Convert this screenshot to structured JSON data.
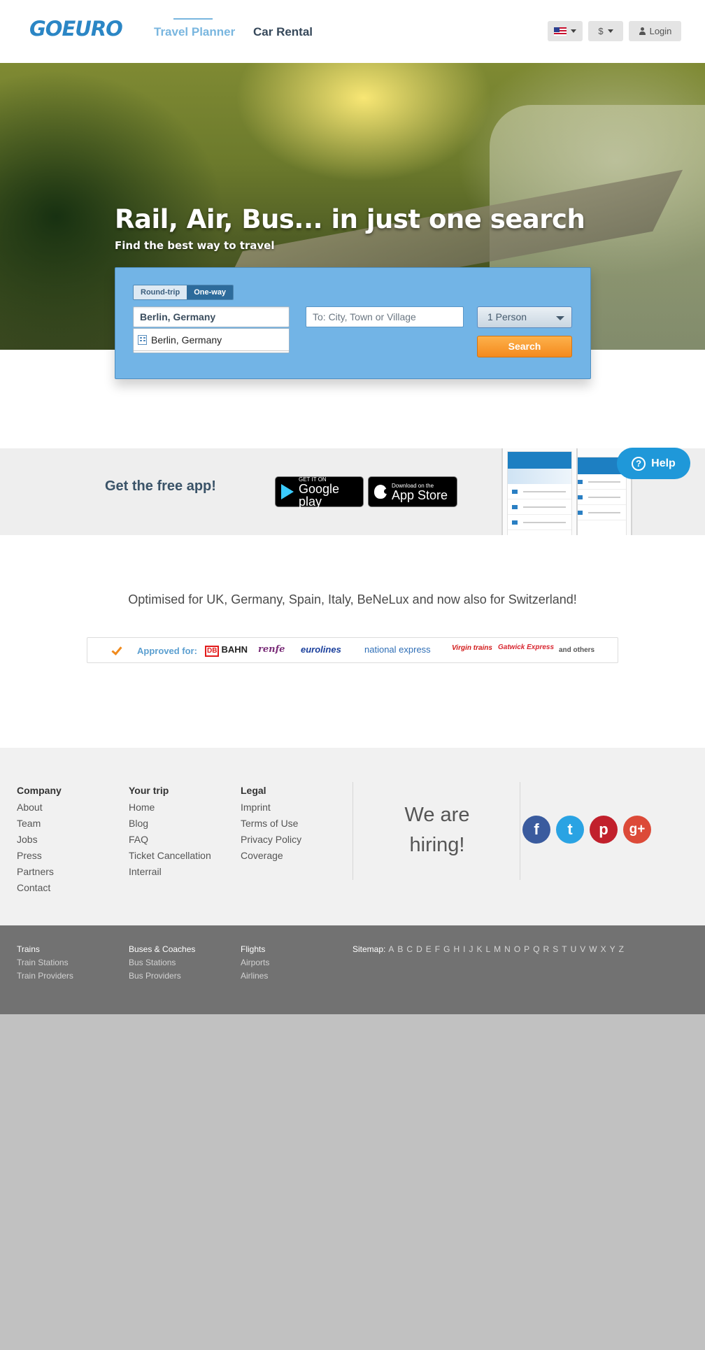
{
  "header": {
    "logo": "GOEURO",
    "nav": {
      "travel_planner": "Travel Planner",
      "car_rental": "Car Rental"
    },
    "currency": "$",
    "login": "Login"
  },
  "hero": {
    "title": "Rail, Air, Bus... in just one search",
    "subtitle": "Find the best way to travel"
  },
  "search": {
    "trip_types": {
      "round_trip": "Round-trip",
      "one_way": "One-way"
    },
    "selected_trip_type": "One-way",
    "from_value": "Berlin, Germany",
    "to_placeholder": "To: City, Town or Village",
    "suggestion": "Berlin, Germany",
    "persons": "1 Person",
    "search_button": "Search"
  },
  "app_promo": {
    "text": "Get the free app!",
    "google_play": {
      "small": "GET IT ON",
      "big": "Google play"
    },
    "app_store": {
      "small": "Download on the",
      "big": "App Store"
    }
  },
  "help": {
    "label": "Help",
    "glyph": "?"
  },
  "optimised": {
    "text": "Optimised for UK, Germany, Spain, Italy, BeNeLux and now also for Switzerland!",
    "approved_label": "Approved for:",
    "partners": {
      "db_mark": "DB",
      "db_name": "BAHN",
      "renfe": "renfe",
      "eurolines": "eurolines",
      "national_express": "national express",
      "virgin": "Virgin trains",
      "gatwick": "Gatwick Express",
      "others": "and others"
    }
  },
  "footer": {
    "company": {
      "heading": "Company",
      "links": [
        "About",
        "Team",
        "Jobs",
        "Press",
        "Partners",
        "Contact"
      ]
    },
    "your_trip": {
      "heading": "Your trip",
      "links": [
        "Home",
        "Blog",
        "FAQ",
        "Ticket Cancellation",
        "Interrail"
      ]
    },
    "legal": {
      "heading": "Legal",
      "links": [
        "Imprint",
        "Terms of Use",
        "Privacy Policy",
        "Coverage"
      ]
    },
    "hiring": "We are hiring!",
    "social": {
      "facebook": "f",
      "twitter": "t",
      "pinterest": "p",
      "googleplus": "g+"
    }
  },
  "subfooter": {
    "trains": {
      "heading": "Trains",
      "links": [
        "Train Stations",
        "Train Providers"
      ]
    },
    "buses": {
      "heading": "Buses & Coaches",
      "links": [
        "Bus Stations",
        "Bus Providers"
      ]
    },
    "flights": {
      "heading": "Flights",
      "links": [
        "Airports",
        "Airlines"
      ]
    },
    "sitemap_label": "Sitemap:",
    "letters": [
      "A",
      "B",
      "C",
      "D",
      "E",
      "F",
      "G",
      "H",
      "I",
      "J",
      "K",
      "L",
      "M",
      "N",
      "O",
      "P",
      "Q",
      "R",
      "S",
      "T",
      "U",
      "V",
      "W",
      "X",
      "Y",
      "Z"
    ]
  },
  "colors": {
    "brand_blue": "#2b86c5",
    "search_panel": "#72b4e6",
    "search_button": "#f48a1e",
    "help_button": "#1f98d9"
  }
}
